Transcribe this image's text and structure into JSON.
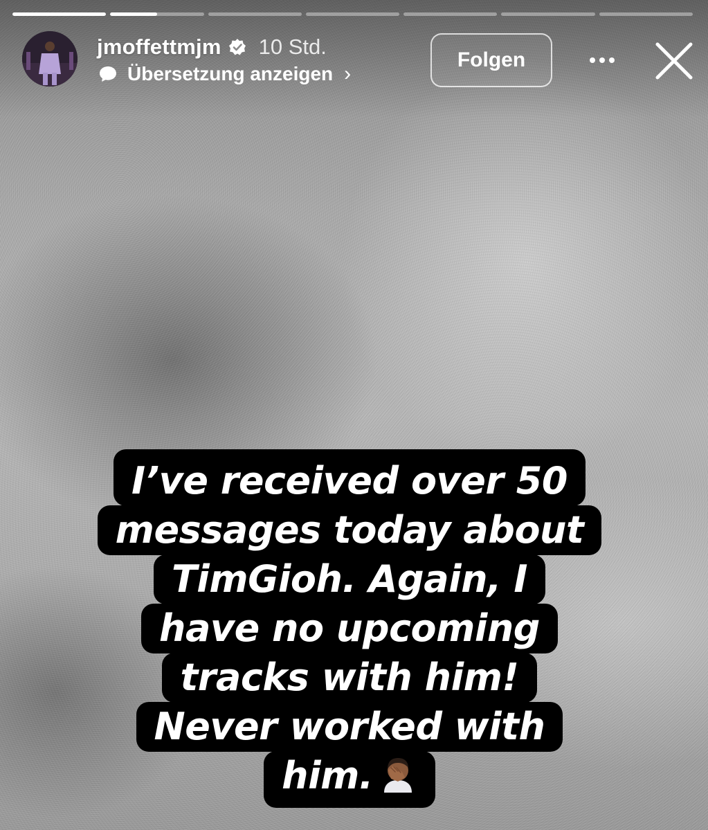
{
  "story": {
    "progress_segments": [
      1.0,
      0.5,
      0.0,
      0.0,
      0.0,
      0.0,
      0.0
    ],
    "header": {
      "username": "jmoffettmjm",
      "verified": true,
      "timestamp": "10 Std.",
      "translate_label": "Übersetzung anzeigen",
      "translate_chevron": "›",
      "follow_label": "Folgen",
      "more_icon": "more-dots-icon",
      "close_icon": "close-icon"
    },
    "caption_lines": [
      "I’ve received over 50",
      "messages today about",
      "TimGioh. Again, I",
      "have no upcoming",
      "tracks with him!",
      "Never worked with",
      "him."
    ],
    "caption_emoji": "face-palm-emoji",
    "colors": {
      "caption_bg": "#000000",
      "caption_text": "#ffffff",
      "verified_badge": "#ffffff"
    }
  }
}
